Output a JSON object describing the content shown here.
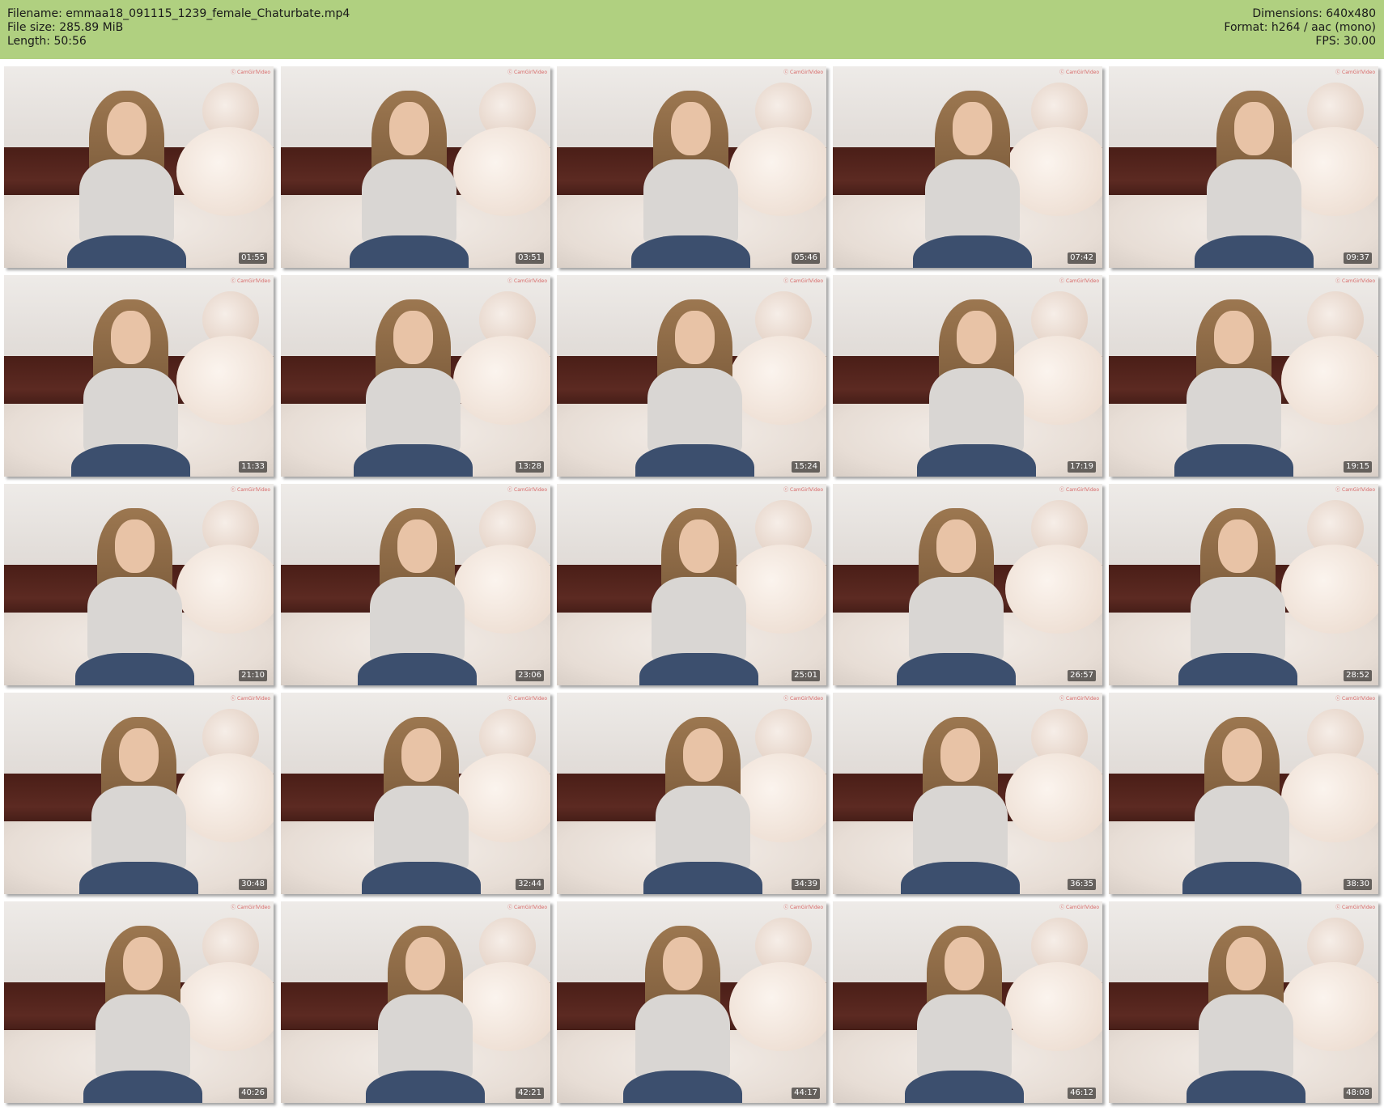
{
  "header": {
    "left_lines": [
      "Filename: emmaa18_091115_1239_female_Chaturbate.mp4",
      "File size: 285.89 MiB",
      "Length: 50:56"
    ],
    "right_lines": [
      "Dimensions: 640x480",
      "Format: h264 / aac (mono)",
      "FPS: 30.00"
    ]
  },
  "thumbnails": [
    "01:55",
    "03:51",
    "05:46",
    "07:42",
    "09:37",
    "11:33",
    "13:28",
    "15:24",
    "17:19",
    "19:15",
    "21:10",
    "23:06",
    "25:01",
    "26:57",
    "28:52",
    "30:48",
    "32:44",
    "34:39",
    "36:35",
    "38:30",
    "40:26",
    "42:21",
    "44:17",
    "46:12",
    "48:08"
  ],
  "watermark_text": "ⓒ CamGirlVideo",
  "colors": {
    "header_bg": "#b0d080",
    "timestamp_bg": "rgba(0,0,0,0.55)",
    "timestamp_text": "#ffffff"
  }
}
